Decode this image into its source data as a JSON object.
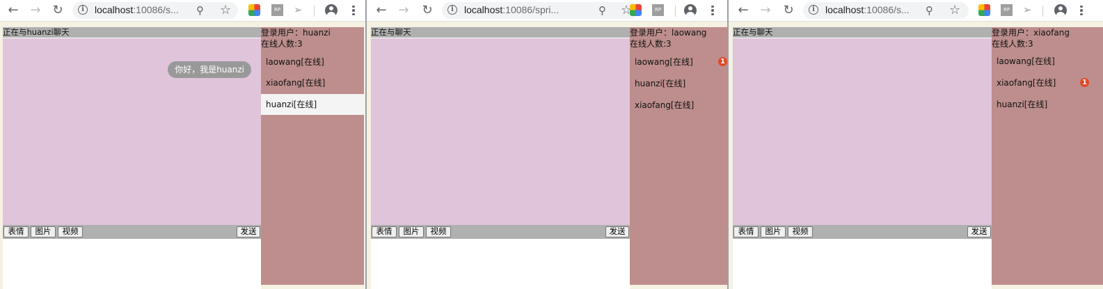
{
  "browser": {
    "urls": [
      {
        "host": "localhost",
        "rest": ":10086/s..."
      },
      {
        "host": "localhost",
        "rest": ":10086/spri..."
      },
      {
        "host": "localhost",
        "rest": ":10086/s..."
      }
    ],
    "ext_rp_label": "RP"
  },
  "windows": [
    {
      "chat_title": "正在与huanzi聊天",
      "message": "你好，我是huanzi",
      "login_user": "登录用户：huanzi",
      "online_count": "在线人数:3",
      "users": [
        {
          "label": "laowang[在线]",
          "active": false,
          "badge": ""
        },
        {
          "label": "xiaofang[在线]",
          "active": false,
          "badge": ""
        },
        {
          "label": "huanzi[在线]",
          "active": true,
          "badge": ""
        }
      ]
    },
    {
      "chat_title": "正在与聊天",
      "message": "",
      "login_user": "登录用户：laowang",
      "online_count": "在线人数:3",
      "users": [
        {
          "label": "laowang[在线]",
          "active": false,
          "badge": "1"
        },
        {
          "label": "huanzi[在线]",
          "active": false,
          "badge": ""
        },
        {
          "label": "xiaofang[在线]",
          "active": false,
          "badge": ""
        }
      ]
    },
    {
      "chat_title": "正在与聊天",
      "message": "",
      "login_user": "登录用户：xiaofang",
      "online_count": "在线人数:3",
      "users": [
        {
          "label": "laowang[在线]",
          "active": false,
          "badge": ""
        },
        {
          "label": "xiaofang[在线]",
          "active": false,
          "badge": "1"
        },
        {
          "label": "huanzi[在线]",
          "active": false,
          "badge": ""
        }
      ]
    }
  ],
  "buttons": {
    "emoji": "表情",
    "image": "图片",
    "video": "视频",
    "send": "发送"
  },
  "colors": {
    "chat_bg": "#e0c4da",
    "sidebar_bg": "#bd8e8d",
    "header_bg": "#b0b0b0",
    "badge": "#e04a2a",
    "bubble": "#999999"
  }
}
